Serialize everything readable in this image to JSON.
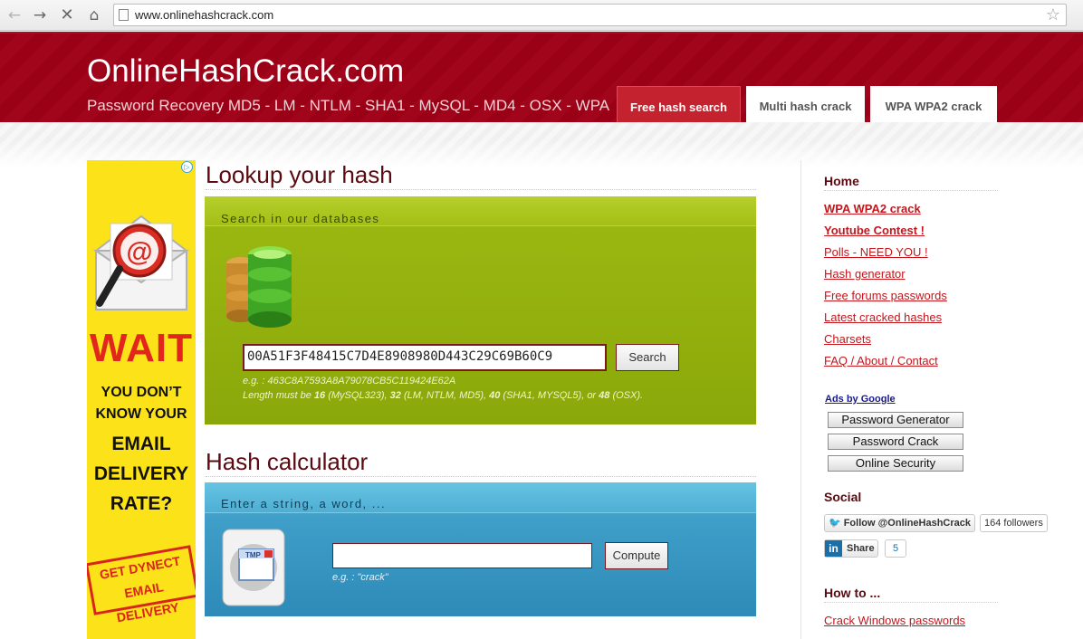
{
  "browser": {
    "url": "www.onlinehashcrack.com",
    "nav_back": "←",
    "nav_forward": "→",
    "nav_stop": "✕",
    "nav_home": "⌂",
    "star": "☆"
  },
  "header": {
    "logo": "OnlineHashCrack.com",
    "tagline": "Password Recovery MD5 - LM - NTLM - SHA1 - MySQL - MD4 - OSX - WPA",
    "tabs": [
      {
        "label": "Free hash search",
        "active": true
      },
      {
        "label": "Multi hash crack",
        "active": false
      },
      {
        "label": "WPA WPA2 crack",
        "active": false
      }
    ]
  },
  "ad": {
    "wait": "WAIT",
    "line1": "YOU DON’T",
    "line2": "KNOW YOUR",
    "line3": "EMAIL",
    "line4": "DELIVERY",
    "line5": "RATE?",
    "stamp1": "GET DYNECT",
    "stamp2": "EMAIL DELIVERY",
    "icon_name": "email-magnifier-icon",
    "colors": {
      "bg": "#fbe219",
      "red": "#e2261c"
    }
  },
  "lookup": {
    "title": "Lookup your hash",
    "panel_label": "Search in our databases",
    "hash_value": "00A51F3F48415C7D4E8908980D443C29C69B60C9",
    "search_button": "Search",
    "hint_example": "e.g. : 463C8A7593A8A79078CB5C119424E62A",
    "hint_length_prefix": "Length must be ",
    "len_16": "16",
    "mysql": " (MySQL323), ",
    "len_32": "32",
    "ntlm": " (LM, NTLM, MD5), ",
    "len_40": "40",
    "sha1": " (SHA1, MYSQL5), or ",
    "len_48": "48",
    "osx": " (OSX)."
  },
  "calculator": {
    "title": "Hash calculator",
    "panel_label": "Enter a string, a word, ...",
    "input_value": "",
    "compute_button": "Compute",
    "hint": "e.g. : \"crack\"",
    "icon_label": "TMP"
  },
  "sidebar": {
    "home_heading": "Home",
    "links": [
      {
        "label": "WPA WPA2 crack",
        "bold": true
      },
      {
        "label": "Youtube Contest !",
        "bold": true
      },
      {
        "label": "Polls - NEED YOU !",
        "bold": false
      },
      {
        "label": "Hash generator",
        "bold": false
      },
      {
        "label": "Free forums passwords",
        "bold": false
      },
      {
        "label": "Latest cracked hashes",
        "bold": false
      },
      {
        "label": "Charsets",
        "bold": false
      },
      {
        "label": "FAQ / About / Contact",
        "bold": false
      }
    ],
    "ads_by": "Ads by Google",
    "ad_buttons": [
      "Password Generator",
      "Password Crack",
      "Online Security"
    ],
    "social_heading": "Social",
    "twitter_follow": "Follow @OnlineHashCrack",
    "twitter_count": "164 followers",
    "linkedin_share": "Share",
    "linkedin_count": "5",
    "howto_heading": "How to ...",
    "howto_link": "Crack Windows passwords"
  },
  "colors": {
    "header_red": "#9a0016",
    "active_tab": "#c4222f",
    "green_panel": "#9ab711",
    "blue_panel": "#3f9fc8",
    "link_red": "#c4161c"
  }
}
